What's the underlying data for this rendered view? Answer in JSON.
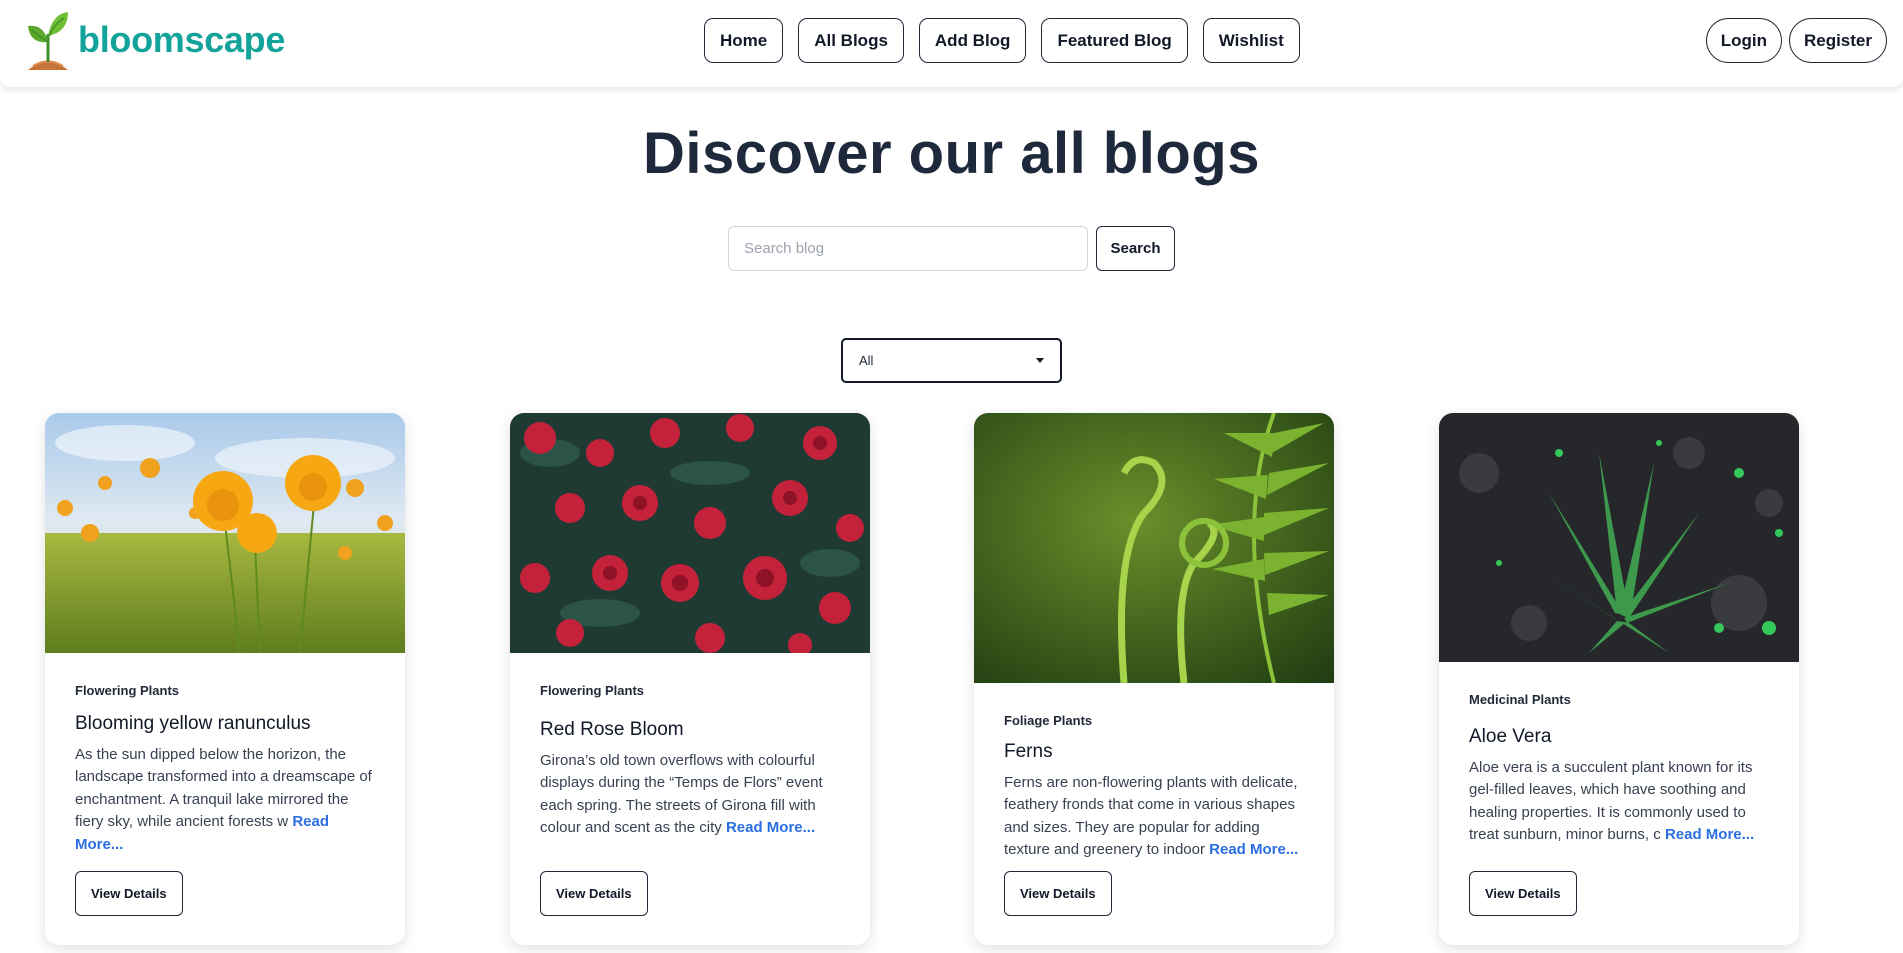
{
  "brand": {
    "name": "bloomscape",
    "logo": "sprout-logo"
  },
  "nav": {
    "links": [
      "Home",
      "All Blogs",
      "Add Blog",
      "Featured Blog",
      "Wishlist"
    ],
    "login": "Login",
    "register": "Register"
  },
  "hero": {
    "title": "Discover our all blogs",
    "search_placeholder": "Search blog",
    "search_button": "Search"
  },
  "filter": {
    "selected": "All"
  },
  "cards": [
    {
      "image": "yellow-ranunculus-photo",
      "category": "Flowering Plants",
      "title": "Blooming yellow ranunculus",
      "description": "As the sun dipped below the horizon, the landscape transformed into a dreamscape of enchantment. A tranquil lake mirrored the fiery sky, while ancient forests w",
      "read_more": "Read More...",
      "button": "View Details"
    },
    {
      "image": "red-roses-photo",
      "category": "Flowering Plants",
      "title": "Red Rose Bloom",
      "description": "Girona’s old town overflows with colourful displays during the “Temps de Flors” event each spring. The streets of Girona fill with colour and scent as the city",
      "read_more": "Read More...",
      "button": "View Details"
    },
    {
      "image": "fern-fronds-photo",
      "category": "Foliage Plants",
      "title": "Ferns",
      "description": "Ferns are non-flowering plants with delicate, feathery fronds that come in various shapes and sizes. They are popular for adding texture and greenery to indoor",
      "read_more": "Read More...",
      "button": "View Details"
    },
    {
      "image": "aloe-vera-photo",
      "category": "Medicinal Plants",
      "title": "Aloe Vera",
      "description": "Aloe vera is a succulent plant known for its gel-filled leaves, which have soothing and healing properties. It is commonly used to treat sunburn, minor burns, c",
      "read_more": "Read More...",
      "button": "View Details"
    }
  ],
  "colors": {
    "brand": "#14a39a",
    "link": "#2b6fe0",
    "heading": "#1e293b"
  }
}
